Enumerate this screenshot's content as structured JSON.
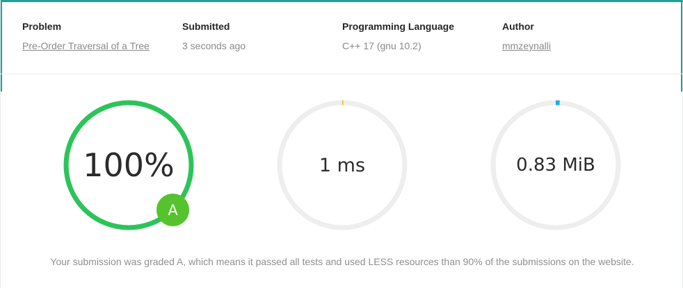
{
  "submission": {
    "problem": {
      "label": "Problem",
      "value": "Pre-Order Traversal of a Tree"
    },
    "submitted": {
      "label": "Submitted",
      "value": "3 seconds ago"
    },
    "language": {
      "label": "Programming Language",
      "value": "C++ 17 (gnu 10.2)"
    },
    "author": {
      "label": "Author",
      "value": "mmzeynalli"
    }
  },
  "results": {
    "score": {
      "text": "100%",
      "fraction": 1.0,
      "color": "#2cc45a"
    },
    "time": {
      "text": "1 ms",
      "fraction": 0.003,
      "color": "#f0c419"
    },
    "memory": {
      "text": "0.83 MiB",
      "fraction": 0.01,
      "color": "#1ab1e3"
    },
    "track_color": "#eeeeee",
    "grade": {
      "letter": "A",
      "color": "#55c32e"
    }
  },
  "summary_text": "Your submission was graded A, which means it passed all tests and used LESS resources than 90% of the submissions on the website."
}
